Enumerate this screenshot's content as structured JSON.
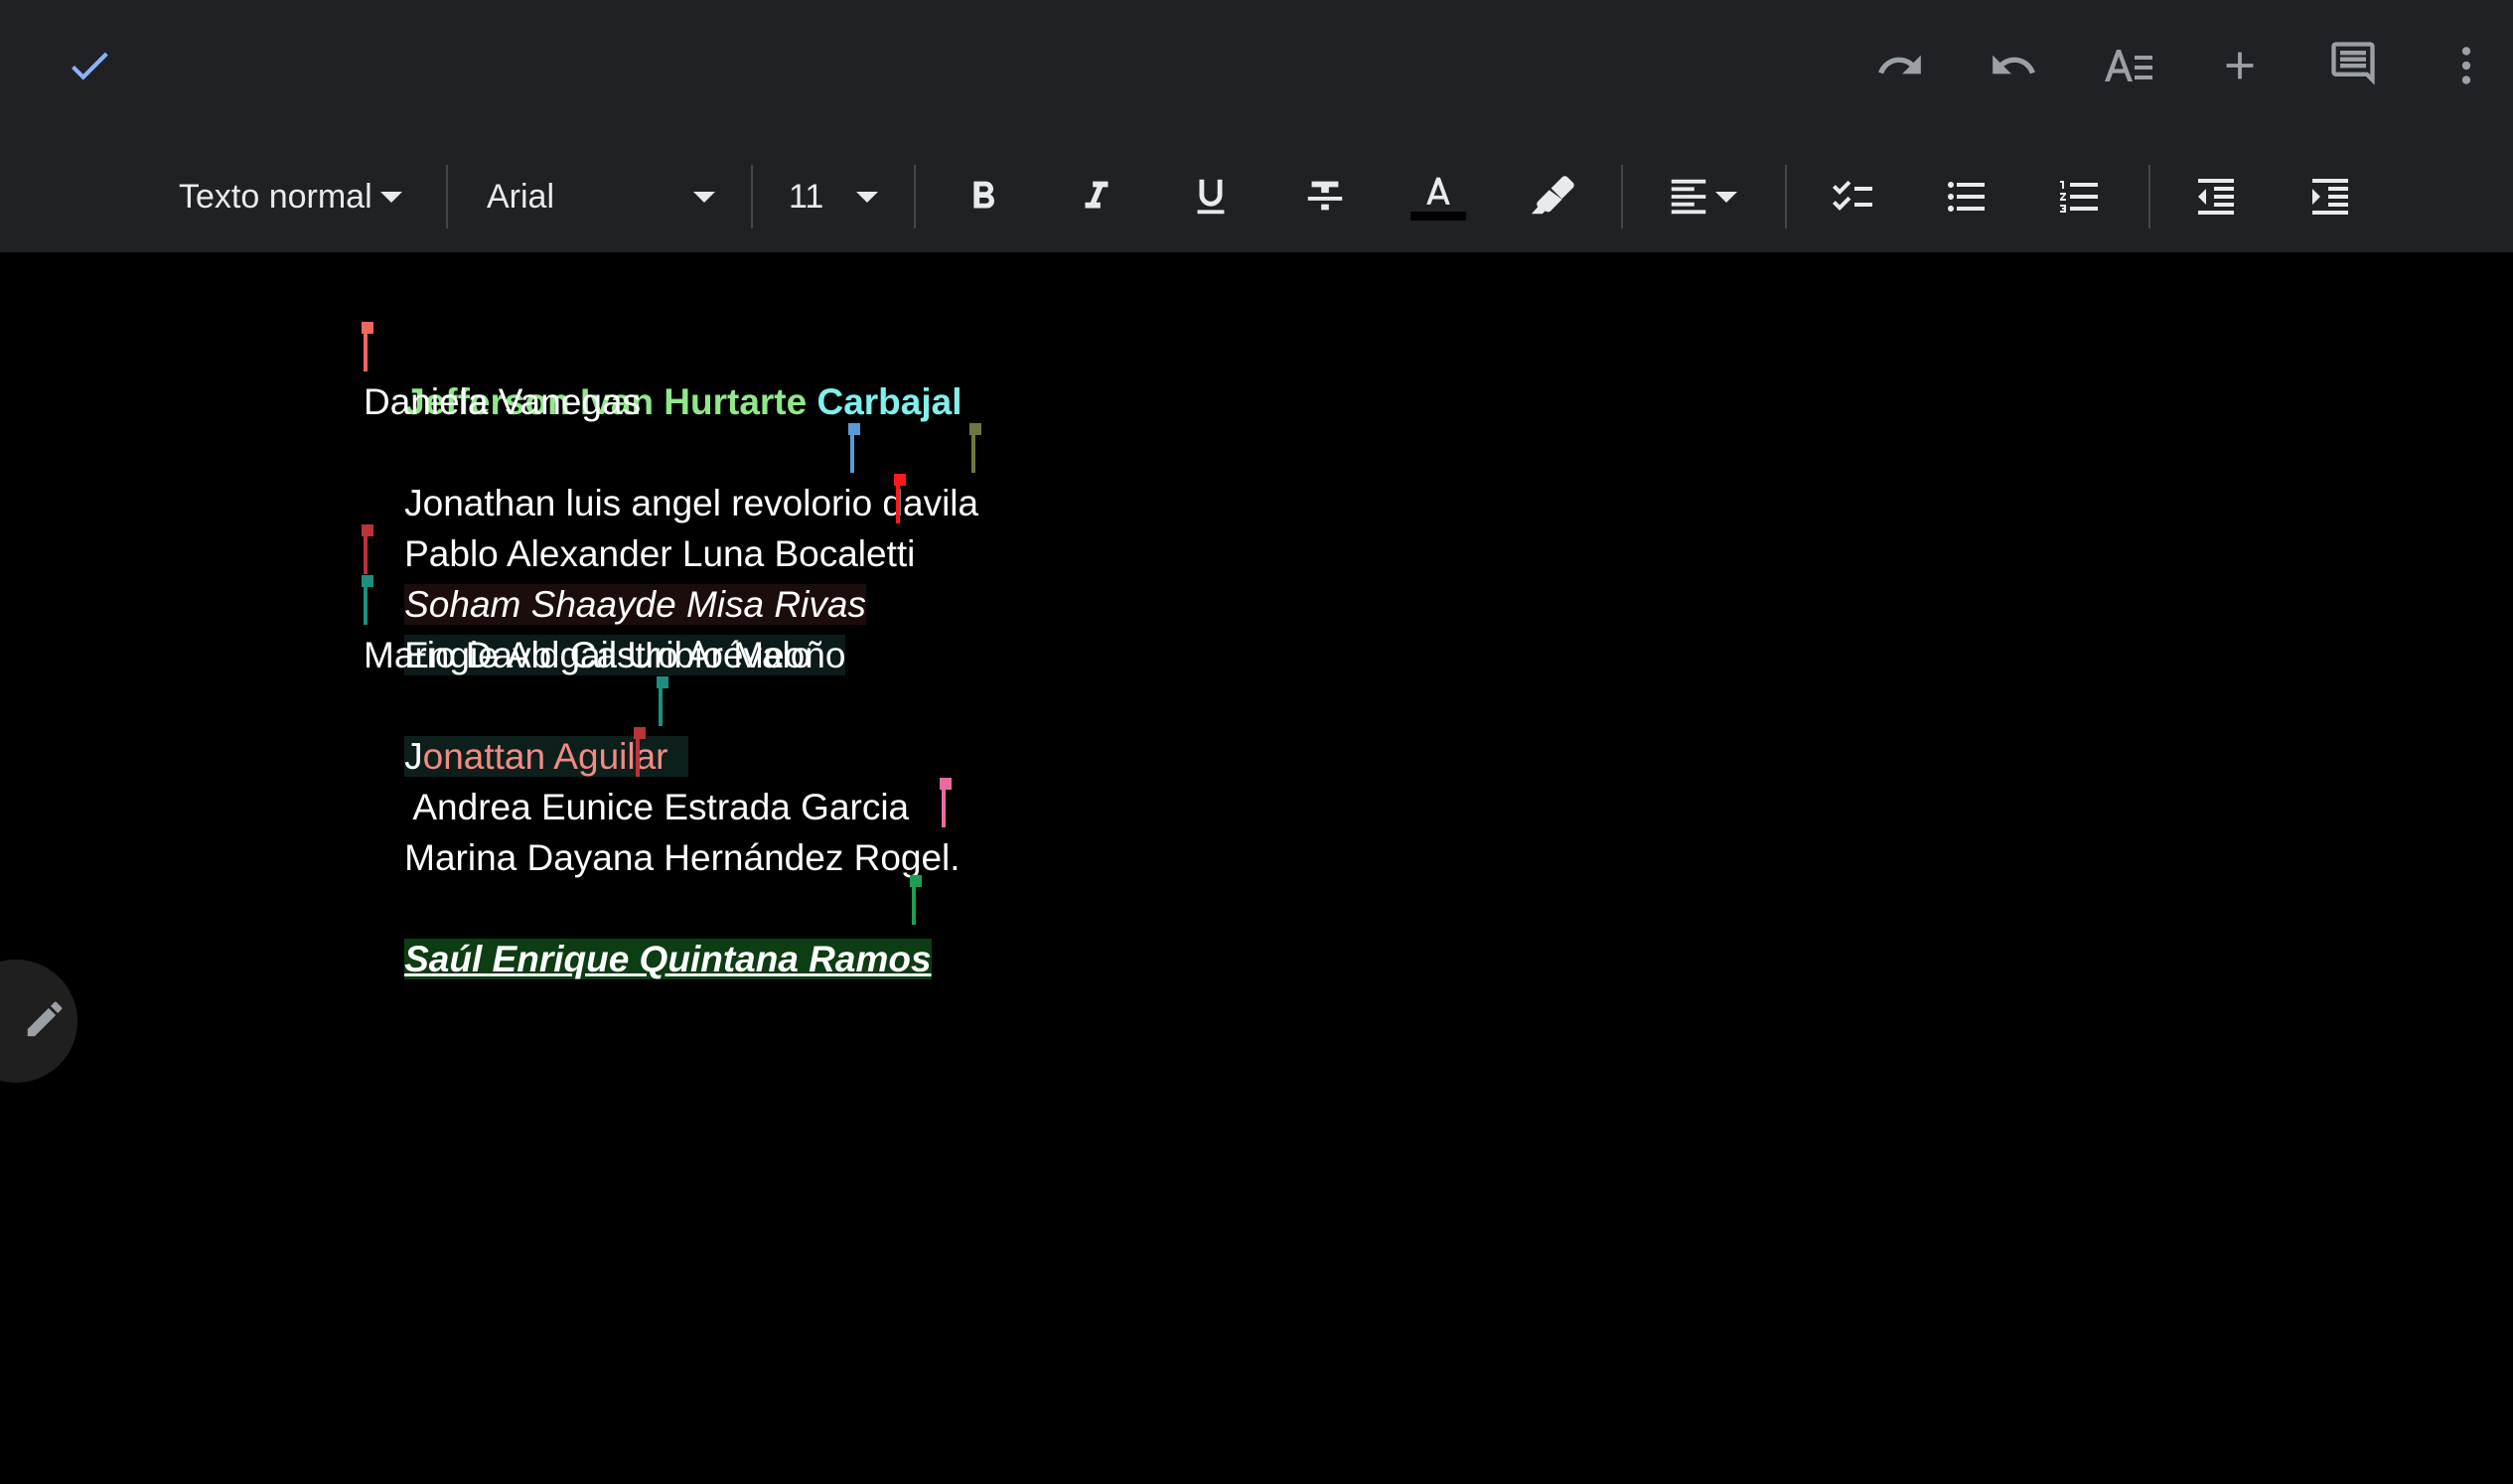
{
  "toolbar": {
    "style_dropdown": "Texto normal",
    "font_dropdown": "Arial",
    "size_dropdown": "11",
    "text_color_bar": "#000000"
  },
  "document": {
    "line1": {
      "part1": "Jefferson Ivan Hurtarte ",
      "part2": "Carbajal",
      "color1": "#90e88a",
      "color2": "#7ff0ee"
    },
    "line2": "Daniela Vanegas",
    "line3": "Jonathan luis angel revolorio davila",
    "line4": "Pablo Alexander Luna Bocaletti",
    "line5": "Soham Shaayde Misa Rivas",
    "line6": "Engie Abigail Uribio Meoño",
    "line7": "Mario David Castro Arévalo",
    "line8": {
      "part1": "J",
      "part2": "onattan Aguilar",
      "color2": "#f28b82"
    },
    "line9": " Andrea Eunice Estrada Garcia",
    "line10": "Marina Dayana Hernández Rogel.",
    "line11": "Saúl Enrique Quintana Ramos"
  },
  "cursor_colors": [
    "#ee675c",
    "#5a9bd5",
    "#6b7a3a",
    "#ff1a1a",
    "#b8333a",
    "#1e8e7e",
    "#1e8e7e",
    "#b8333a",
    "#e86aa0",
    "#1e9e50"
  ],
  "icons": [
    "done-check-icon",
    "undo-icon",
    "redo-icon",
    "text-format-icon",
    "insert-plus-icon",
    "comment-icon",
    "more-vert-icon",
    "bold-icon",
    "italic-icon",
    "underline-icon",
    "strikethrough-icon",
    "text-color-icon",
    "highlight-icon",
    "align-left-icon",
    "checklist-icon",
    "bullet-list-icon",
    "numbered-list-icon",
    "decrease-indent-icon",
    "increase-indent-icon",
    "edit-pencil-icon"
  ]
}
